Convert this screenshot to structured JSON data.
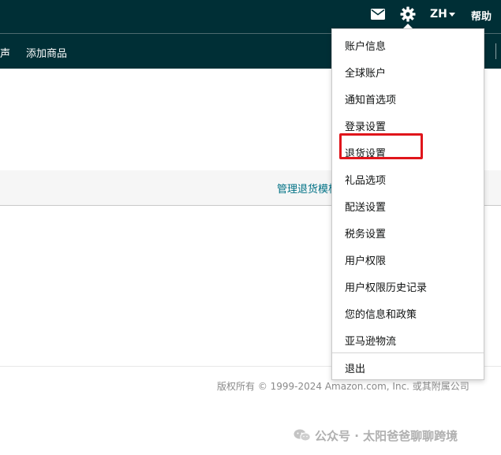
{
  "header": {
    "language": "ZH",
    "help": "帮助",
    "icons": {
      "mail": "mail-icon",
      "settings": "gear-icon",
      "caret": "caret-down-icon"
    }
  },
  "nav": {
    "items": [
      "声",
      "添加商品"
    ]
  },
  "main": {
    "manage_link": "管理退货模板"
  },
  "settings_menu": {
    "items": [
      "账户信息",
      "全球账户",
      "通知首选项",
      "登录设置",
      "退货设置",
      "礼品选项",
      "配送设置",
      "税务设置",
      "用户权限",
      "用户权限历史记录",
      "您的信息和政策",
      "亚马逊物流"
    ],
    "logout": "退出",
    "highlighted": "退货设置"
  },
  "footer": {
    "copyright": "版权所有 © 1999-2024 Amazon.com, Inc. 或其附属公司"
  },
  "watermark": {
    "text": "公众号 · 太阳爸爸聊聊跨境"
  },
  "colors": {
    "header_bg": "#002f36",
    "link": "#007185",
    "highlight_border": "#e0151b"
  }
}
